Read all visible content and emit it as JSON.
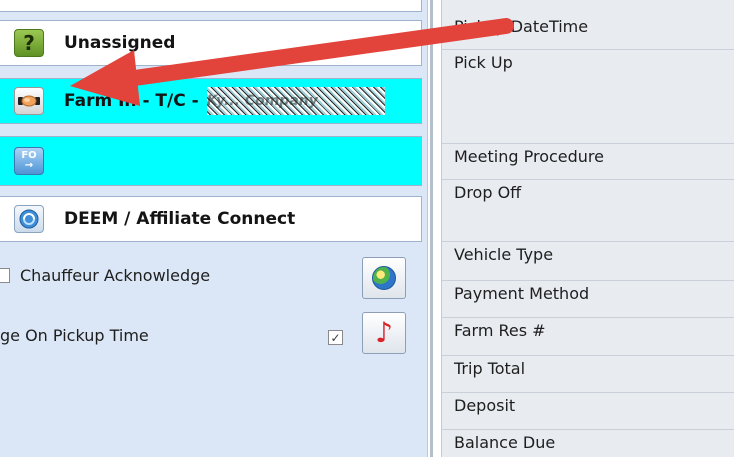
{
  "assignment": {
    "unassigned_label": "Unassigned",
    "farmin_label": "Farm In - T/C -",
    "farmin_redacted": "Ky... Company",
    "fo_icon_text": "FO",
    "deem_label": "DEEM / Affiliate Connect"
  },
  "options": {
    "chauffeur_ack_label": "Chauffeur Acknowledge",
    "pickup_time_label": "ge On Pickup Time",
    "pickup_time_checked": "✓"
  },
  "trip_fields": [
    "Pickup DateTime",
    "Pick Up",
    "Meeting Procedure",
    "Drop Off",
    "Vehicle Type",
    "Payment Method",
    "Farm Res #",
    "Trip Total",
    "Deposit",
    "Balance Due"
  ],
  "colors": {
    "highlight_row": "#00ffff",
    "left_panel_bg": "#dbe7f6",
    "arrow": "#e2433a"
  },
  "icons": {
    "unassigned": "question-icon",
    "farmin": "handshake-icon",
    "fo": "fo-icon",
    "deem": "deem-connect-icon",
    "globe": "globe-icon",
    "sound": "music-note-icon"
  }
}
